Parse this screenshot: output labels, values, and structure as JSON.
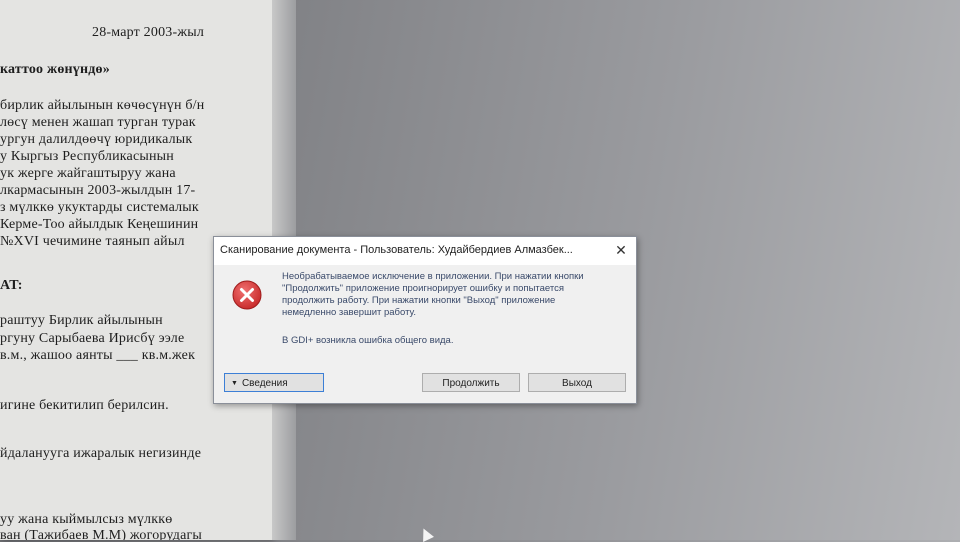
{
  "document": {
    "lines": [
      {
        "text": "28-март 2003-жыл",
        "bold": false
      },
      {
        "text": "каттоо жөнүндө»",
        "bold": true
      },
      {
        "text": "бирлик айылынын көчөсүнүн б/н",
        "bold": false
      },
      {
        "text": "лөсү менен жашап турган турак",
        "bold": false
      },
      {
        "text": "ургун далилдөөчү юридикалык",
        "bold": false
      },
      {
        "text": "у Кыргыз Республикасынын",
        "bold": false
      },
      {
        "text": "ук жерге жайгаштыруу жана",
        "bold": false
      },
      {
        "text": "лкармасынын 2003-жылдын 17-",
        "bold": false
      },
      {
        "text": "з мүлккө укуктарды системалык",
        "bold": false
      },
      {
        "text": "Керме-Тоо айылдык Кеңешинин",
        "bold": false
      },
      {
        "text": "№XVI чечимине таянып айыл",
        "bold": false
      },
      {
        "text": "AT:",
        "bold": true
      },
      {
        "text": "раштуу Бирлик айылынын",
        "bold": false
      },
      {
        "text": "ргуну Сарыбаева Ирисбү ээле",
        "bold": false
      },
      {
        "text": "в.м., жашоо аянты ___ кв.м.жек",
        "bold": false
      },
      {
        "text": "игине бекитилип берилсин.",
        "bold": false
      },
      {
        "text": "йдаланууга ижаралык негизинде",
        "bold": false
      },
      {
        "text": "уу жана кыймылсыз мүлккө",
        "bold": false
      },
      {
        "text": "ван (Тажибаев М.М) жогорудагы",
        "bold": false
      }
    ]
  },
  "dialog": {
    "title": "Сканирование документа - Пользователь: Худайбердиев Алмазбек...",
    "close_glyph": "✕",
    "message": "Необрабатываемое исключение в приложении. При нажатии кнопки \"Продолжить\" приложение проигнорирует ошибку и попытается продолжить работу. При нажатии кнопки \"Выход\" приложение немедленно завершит работу.",
    "detail": "В GDI+ возникла ошибка общего вида.",
    "buttons": {
      "details": "Сведения",
      "details_caret": "▼",
      "continue": "Продолжить",
      "exit": "Выход"
    },
    "icon": "error-icon",
    "icon_color": "#d32f2f"
  }
}
